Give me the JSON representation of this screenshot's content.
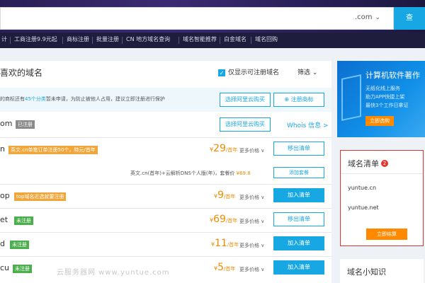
{
  "search": {
    "tld": ".com",
    "button_label": "查"
  },
  "nav": [
    "计",
    "工商注册9.9元起",
    "商标注册",
    "批量注册",
    "CN 地方域名查询",
    "域名智能推荐",
    "白金域名",
    "域名回购"
  ],
  "main": {
    "title": "喜欢的域名",
    "only_available_label": "仅显示可注册域名",
    "filter_label": "筛选",
    "tip": {
      "prefix": "的商标还有",
      "highlight": "45个分类",
      "suffix": "暂未申请，为防止被他人占用，建议立即注册进行保护",
      "buy_button": "选择阿里云购买",
      "register_button": "注册商标"
    },
    "rows": [
      {
        "name": "om",
        "badge": "已注册",
        "badge_color": "gray",
        "action": "选择阿里云购买",
        "link": "Whois 信息 >"
      },
      {
        "name": "n",
        "badge": "英文.cn单笔订单注册50个，特元/首年",
        "badge_color": "orange",
        "price_symbol": "¥",
        "price": "29",
        "unit": "/首年",
        "more": "更多价格 ∨",
        "action": "移出清单",
        "action_style": "outline"
      },
      {
        "combo": "英文.cn(首年)",
        "combo_plus": "+云解析DNS个人版(年)，套餐价",
        "combo_price": "¥69.8",
        "action": "添加套餐",
        "action_style": "outline"
      },
      {
        "name": "op",
        "badge": "top域名近选就要注册",
        "badge_color": "orange",
        "price_symbol": "¥",
        "price": "9",
        "unit": "/首年",
        "more": "更多价格 ∨",
        "action": "加入清单",
        "action_style": "solid"
      },
      {
        "name": "et",
        "badge": "未注册",
        "badge_color": "green",
        "price_symbol": "¥",
        "price": "69",
        "unit": "/首年",
        "more": "更多价格 ∨",
        "action": "移出清单",
        "action_style": "outline"
      },
      {
        "name": "d",
        "badge": "未注册",
        "badge_color": "green",
        "price_symbol": "¥",
        "price": "11",
        "unit": "/首年",
        "more": "更多价格 ∨",
        "action": "加入清单",
        "action_style": "solid"
      },
      {
        "name": "cu",
        "badge": "未注册",
        "badge_color": "green",
        "price_symbol": "¥",
        "price": "5",
        "unit": "/首年",
        "more": "更多价格 ∨",
        "action": "加入清单",
        "action_style": "solid"
      }
    ]
  },
  "ad": {
    "title": "计算机软件著作",
    "line1": "无纸化线上服务",
    "line2": "助力APP快捷上架",
    "line3": "最快3个工作日拿证",
    "button": "立即选购"
  },
  "cart": {
    "title": "域名清单",
    "count": "2",
    "items": [
      "yuntue.cn",
      "yuntue.net"
    ],
    "button": "立即结算"
  },
  "knowledge": {
    "title": "域名小知识"
  },
  "watermark": "云服务器网 www.yuntue.com",
  "colors": {
    "accent": "#17a8e3",
    "price": "#f08c00",
    "cart_border": "#e3342f"
  }
}
